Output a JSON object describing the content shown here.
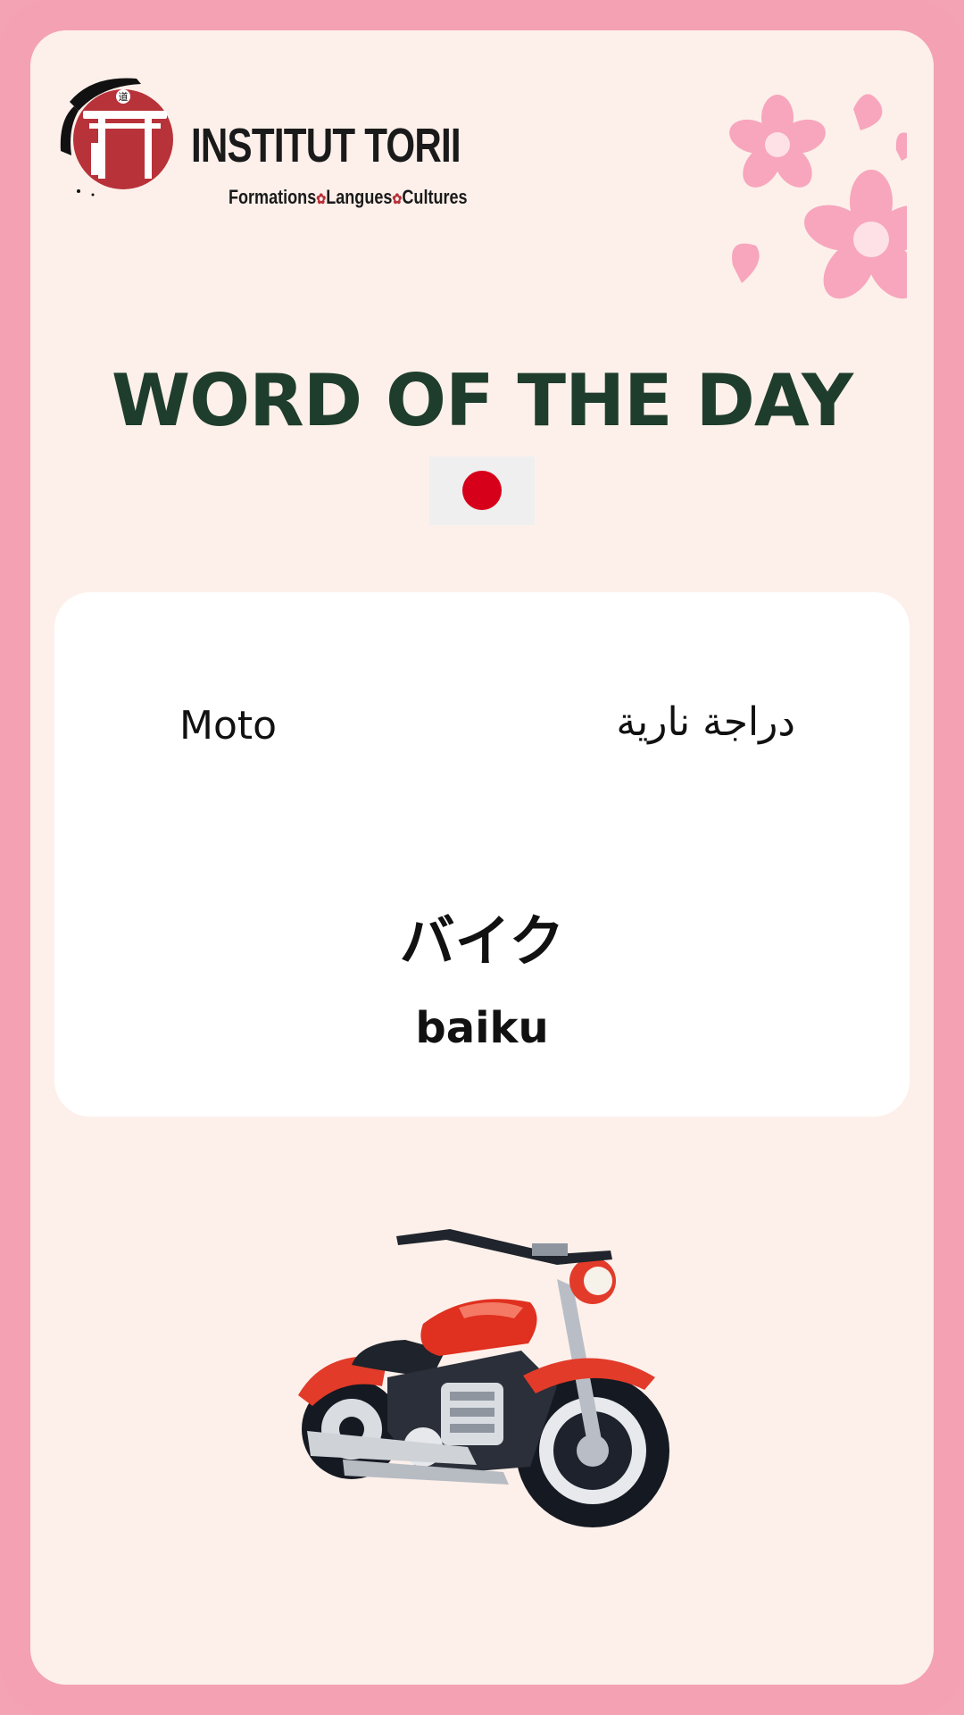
{
  "brand": {
    "name": "INSTITUT TORII",
    "tagline": [
      "Formations",
      "Langues",
      "Cultures"
    ],
    "logo_text": "道",
    "color_red": "#b8323a"
  },
  "title": "WORD OF THE DAY",
  "flag": {
    "country": "Japan",
    "icon": "japan-flag-icon",
    "color": "#d7001a"
  },
  "word": {
    "french": "Moto",
    "arabic": "دراجة نارية",
    "japanese": "バイク",
    "romaji": "baiku"
  },
  "illustration": {
    "icon": "motorcycle-icon"
  },
  "colors": {
    "border": "#f4a2b3",
    "background": "#fdf0ea",
    "title": "#1f3d2c",
    "card": "#ffffff",
    "blossom": "#f7a6bd"
  }
}
